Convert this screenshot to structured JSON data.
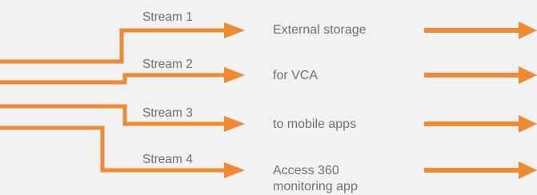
{
  "accent_color": "#f08a30",
  "text_color": "#707070",
  "streams": [
    {
      "label": "Stream 1",
      "destination": "External storage"
    },
    {
      "label": "Stream 2",
      "destination": "for VCA"
    },
    {
      "label": "Stream 3",
      "destination": "to mobile apps"
    },
    {
      "label": "Stream 4",
      "destination": "Access 360 monitoring app"
    }
  ]
}
